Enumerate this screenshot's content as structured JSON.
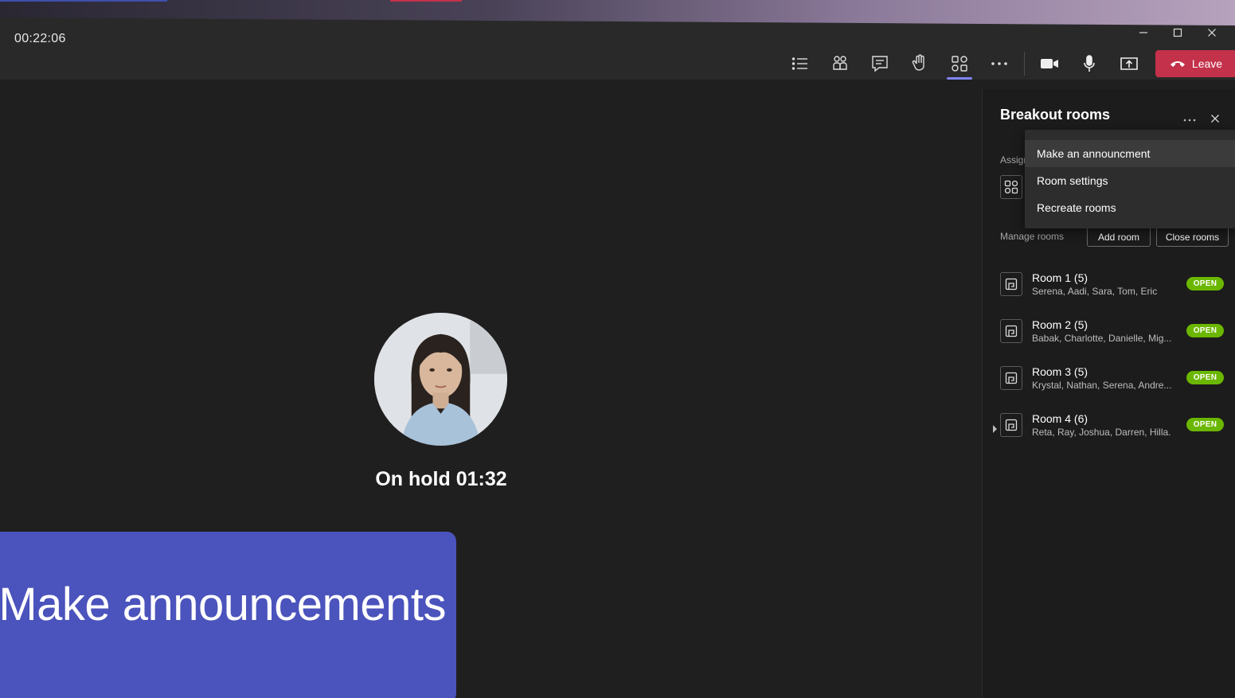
{
  "meeting": {
    "timer": "00:22:06"
  },
  "toolbar": {
    "items": [
      {
        "icon": "list-icon"
      },
      {
        "icon": "people-icon"
      },
      {
        "icon": "chat-icon"
      },
      {
        "icon": "raise-hand-icon"
      },
      {
        "icon": "breakout-rooms-icon",
        "active": true
      },
      {
        "icon": "more-icon"
      },
      {
        "icon": "camera-icon"
      },
      {
        "icon": "microphone-icon"
      },
      {
        "icon": "share-icon"
      }
    ],
    "leave_label": "Leave"
  },
  "window_controls": [
    "minimize",
    "maximize",
    "close"
  ],
  "stage": {
    "on_hold_text": "On hold 01:32",
    "banner_text": "Make announcements"
  },
  "panel": {
    "title": "Breakout rooms",
    "assign_label": "Assign",
    "manage_label": "Manage rooms",
    "add_room_label": "Add room",
    "close_rooms_label": "Close rooms",
    "rooms": [
      {
        "name": "Room 1 (5)",
        "members": "Serena, Aadi, Sara, Tom, Eric",
        "status": "OPEN",
        "expandable": false
      },
      {
        "name": "Room 2 (5)",
        "members": "Babak, Charlotte, Danielle, Mig...",
        "status": "OPEN",
        "expandable": false
      },
      {
        "name": "Room 3 (5)",
        "members": "Krystal, Nathan, Serena, Andre...",
        "status": "OPEN",
        "expandable": false
      },
      {
        "name": "Room 4 (6)",
        "members": "Reta, Ray, Joshua, Darren, Hilla...",
        "status": "OPEN",
        "expandable": true
      }
    ]
  },
  "menu": {
    "items": [
      {
        "label": "Make an announcment",
        "hover": true
      },
      {
        "label": "Room settings",
        "hover": false
      },
      {
        "label": "Recreate rooms",
        "hover": false
      }
    ]
  },
  "colors": {
    "leave": "#c4314b",
    "accent": "#7f85f5",
    "banner": "#4b53bc",
    "open_badge": "#6bb700"
  }
}
